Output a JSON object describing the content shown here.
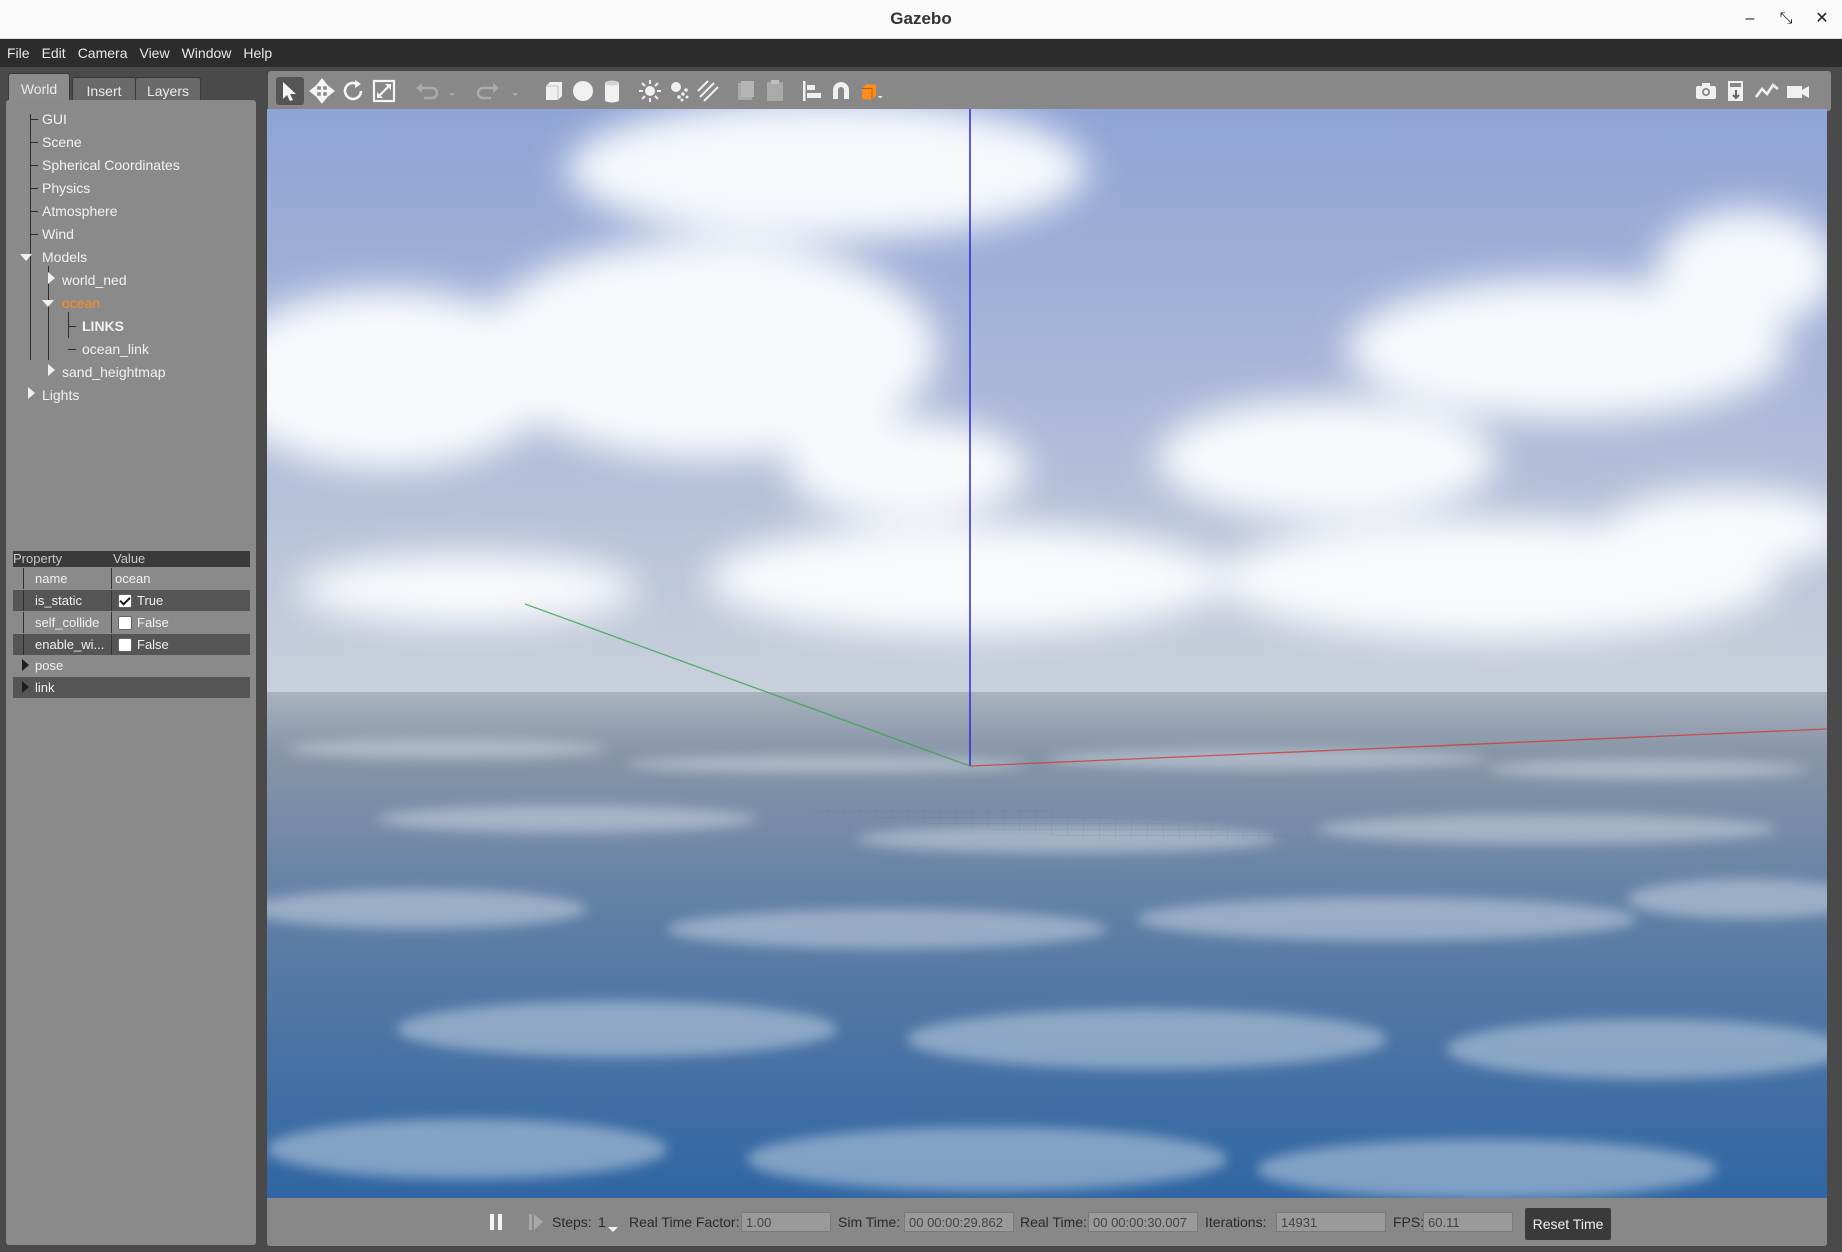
{
  "window": {
    "title": "Gazebo",
    "minimize": "–",
    "restore": "⤡",
    "close": "✕"
  },
  "menu": [
    "File",
    "Edit",
    "Camera",
    "View",
    "Window",
    "Help"
  ],
  "tabs": {
    "world": "World",
    "insert": "Insert",
    "layers": "Layers"
  },
  "tree": {
    "gui": "GUI",
    "scene": "Scene",
    "spherical": "Spherical Coordinates",
    "physics": "Physics",
    "atmosphere": "Atmosphere",
    "wind": "Wind",
    "models": "Models",
    "world_ned": "world_ned",
    "ocean": "ocean",
    "links": "LINKS",
    "ocean_link": "ocean_link",
    "sand_heightmap": "sand_heightmap",
    "lights": "Lights"
  },
  "properties": {
    "header": {
      "property": "Property",
      "value": "Value"
    },
    "rows": [
      {
        "name": "name",
        "value": "ocean"
      },
      {
        "name": "is_static",
        "value": "True",
        "checked": true
      },
      {
        "name": "self_collide",
        "value": "False",
        "checked": false
      },
      {
        "name": "enable_wi...",
        "value": "False",
        "checked": false
      },
      {
        "name": "pose"
      },
      {
        "name": "link"
      }
    ]
  },
  "status": {
    "steps_label": "Steps:",
    "steps_value": "1",
    "rtf_label": "Real Time Factor:",
    "rtf_value": "1.00",
    "sim_label": "Sim Time:",
    "sim_value": "00 00:00:29.862",
    "real_label": "Real Time:",
    "real_value": "00 00:00:30.007",
    "iter_label": "Iterations:",
    "iter_value": "14931",
    "fps_label": "FPS:",
    "fps_value": "60.11",
    "reset_label": "Reset Time"
  },
  "colors": {
    "accent_orange": "#ff8c1a",
    "axis_x": "#d23a3a",
    "axis_y": "#3aa34a",
    "axis_z": "#2a2ad8",
    "sky_top": "#8fa6d6",
    "sea": "#3f6fa3"
  }
}
